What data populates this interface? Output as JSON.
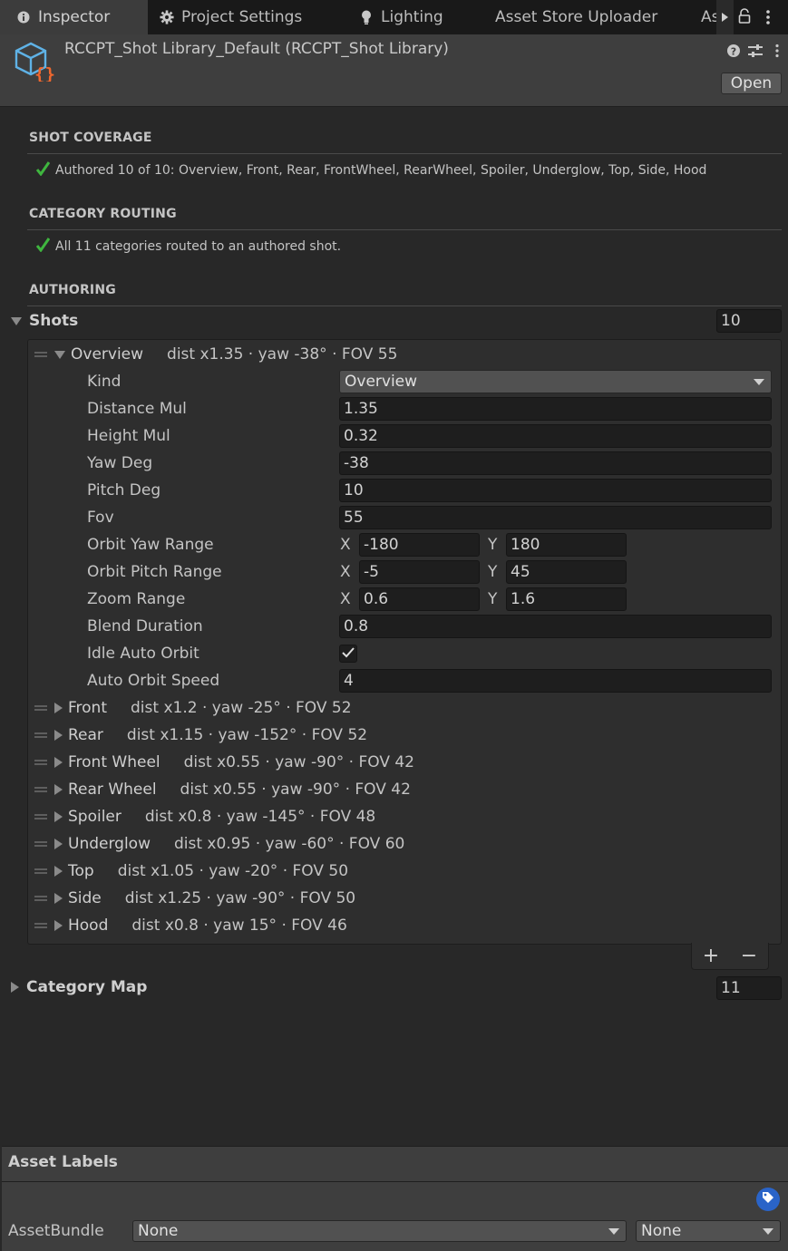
{
  "tabs": [
    {
      "label": "Inspector",
      "icon": "info-icon",
      "active": true
    },
    {
      "label": "Project Settings",
      "icon": "gear-icon",
      "active": false
    },
    {
      "label": "Lighting",
      "icon": "bulb-icon",
      "active": false
    },
    {
      "label": "Asset Store Uploader",
      "icon": "",
      "active": false
    },
    {
      "label": "As",
      "icon": "",
      "active": false
    }
  ],
  "header": {
    "title": "RCCPT_Shot Library_Default (RCCPT_Shot Library)",
    "open_label": "Open",
    "icon": "scriptable-object-icon"
  },
  "sections": {
    "coverage_title": "SHOT COVERAGE",
    "coverage_status": "Authored 10 of 10: Overview, Front, Rear, FrontWheel, RearWheel, Spoiler, Underglow, Top, Side, Hood",
    "routing_title": "CATEGORY ROUTING",
    "routing_status": "All 11 categories routed to an authored shot.",
    "authoring_title": "AUTHORING"
  },
  "shots": {
    "label": "Shots",
    "count": "10",
    "expanded": {
      "name": "Overview",
      "summary": "dist x1.35 · yaw -38° · FOV 55",
      "fields": {
        "kind_label": "Kind",
        "kind_value": "Overview",
        "distance_label": "Distance Mul",
        "distance_value": "1.35",
        "height_label": "Height Mul",
        "height_value": "0.32",
        "yaw_label": "Yaw Deg",
        "yaw_value": "-38",
        "pitch_label": "Pitch Deg",
        "pitch_value": "10",
        "fov_label": "Fov",
        "fov_value": "55",
        "orbit_yaw_label": "Orbit Yaw Range",
        "orbit_yaw_x": "-180",
        "orbit_yaw_y": "180",
        "orbit_pitch_label": "Orbit Pitch Range",
        "orbit_pitch_x": "-5",
        "orbit_pitch_y": "45",
        "zoom_label": "Zoom Range",
        "zoom_x": "0.6",
        "zoom_y": "1.6",
        "blend_label": "Blend Duration",
        "blend_value": "0.8",
        "idle_label": "Idle Auto Orbit",
        "idle_checked": true,
        "speed_label": "Auto Orbit Speed",
        "speed_value": "4",
        "x_letter": "X",
        "y_letter": "Y"
      }
    },
    "rows": [
      {
        "name": "Front",
        "summary": "dist x1.2 · yaw -25° · FOV 52"
      },
      {
        "name": "Rear",
        "summary": "dist x1.15 · yaw -152° · FOV 52"
      },
      {
        "name": "Front Wheel",
        "summary": "dist x0.55 · yaw -90° · FOV 42"
      },
      {
        "name": "Rear Wheel",
        "summary": "dist x0.55 · yaw -90° · FOV 42"
      },
      {
        "name": "Spoiler",
        "summary": "dist x0.8 · yaw -145° · FOV 48"
      },
      {
        "name": "Underglow",
        "summary": "dist x0.95 · yaw -60° · FOV 60"
      },
      {
        "name": "Top",
        "summary": "dist x1.05 · yaw -20° · FOV 50"
      },
      {
        "name": "Side",
        "summary": "dist x1.25 · yaw -90° · FOV 50"
      },
      {
        "name": "Hood",
        "summary": "dist x0.8 · yaw 15° · FOV 46"
      }
    ],
    "add_label": "+",
    "remove_label": "−"
  },
  "category_map": {
    "label": "Category Map",
    "count": "11"
  },
  "asset_labels": {
    "title": "Asset Labels",
    "assetbundle_label": "AssetBundle",
    "bundle_value": "None",
    "variant_value": "None"
  },
  "colors": {
    "check_green": "#3fb63f",
    "tag_blue": "#2a64c8"
  }
}
